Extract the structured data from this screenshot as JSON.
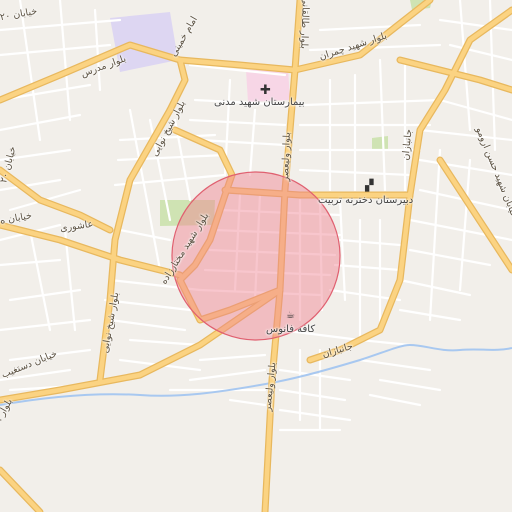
{
  "colors": {
    "background": "#f2efea",
    "minor_street": "#ffffff",
    "major_road": "#fbd382",
    "major_road_casing": "#e8b85e",
    "river": "#a8c8f0",
    "hospital_area": "#f7d6e6",
    "school_area": "#ddd6f2",
    "park": "#cfe3b3",
    "search_circle_fill": "#f08090",
    "search_circle_stroke": "#e06070"
  },
  "search_area": {
    "shape": "circle",
    "opacity": 0.45
  },
  "pois": [
    {
      "name": "hospital",
      "icon": "hospital-cross-icon",
      "glyph": "✚",
      "label": "بیمارستان شهید مدنی"
    },
    {
      "name": "school",
      "icon": "school-icon",
      "glyph": "▞",
      "label": "دبیرستان دخترنه تربیت"
    },
    {
      "name": "cafe",
      "icon": "cafe-icon",
      "glyph": "☕",
      "label": "کافه فانوس"
    }
  ],
  "road_labels": [
    "بلوار شهید چمران",
    "بلوار طالقانی",
    "بلوار ولیعصر",
    "بلوار ولیعصر",
    "بلوار مدرس",
    "بلوار شیخ نوایی",
    "بلوار شیخ نوایی",
    "امام خمینی",
    "خیابان ۲۰",
    "خیابان ۲۰",
    "خیابان ه",
    "عاشوری",
    "بلوار شهید مختارزاده",
    "جانبازان",
    "جانبازان",
    "خیابان شهید حسن ارومو",
    "خیابان دستغیب",
    "بلوار ..."
  ]
}
